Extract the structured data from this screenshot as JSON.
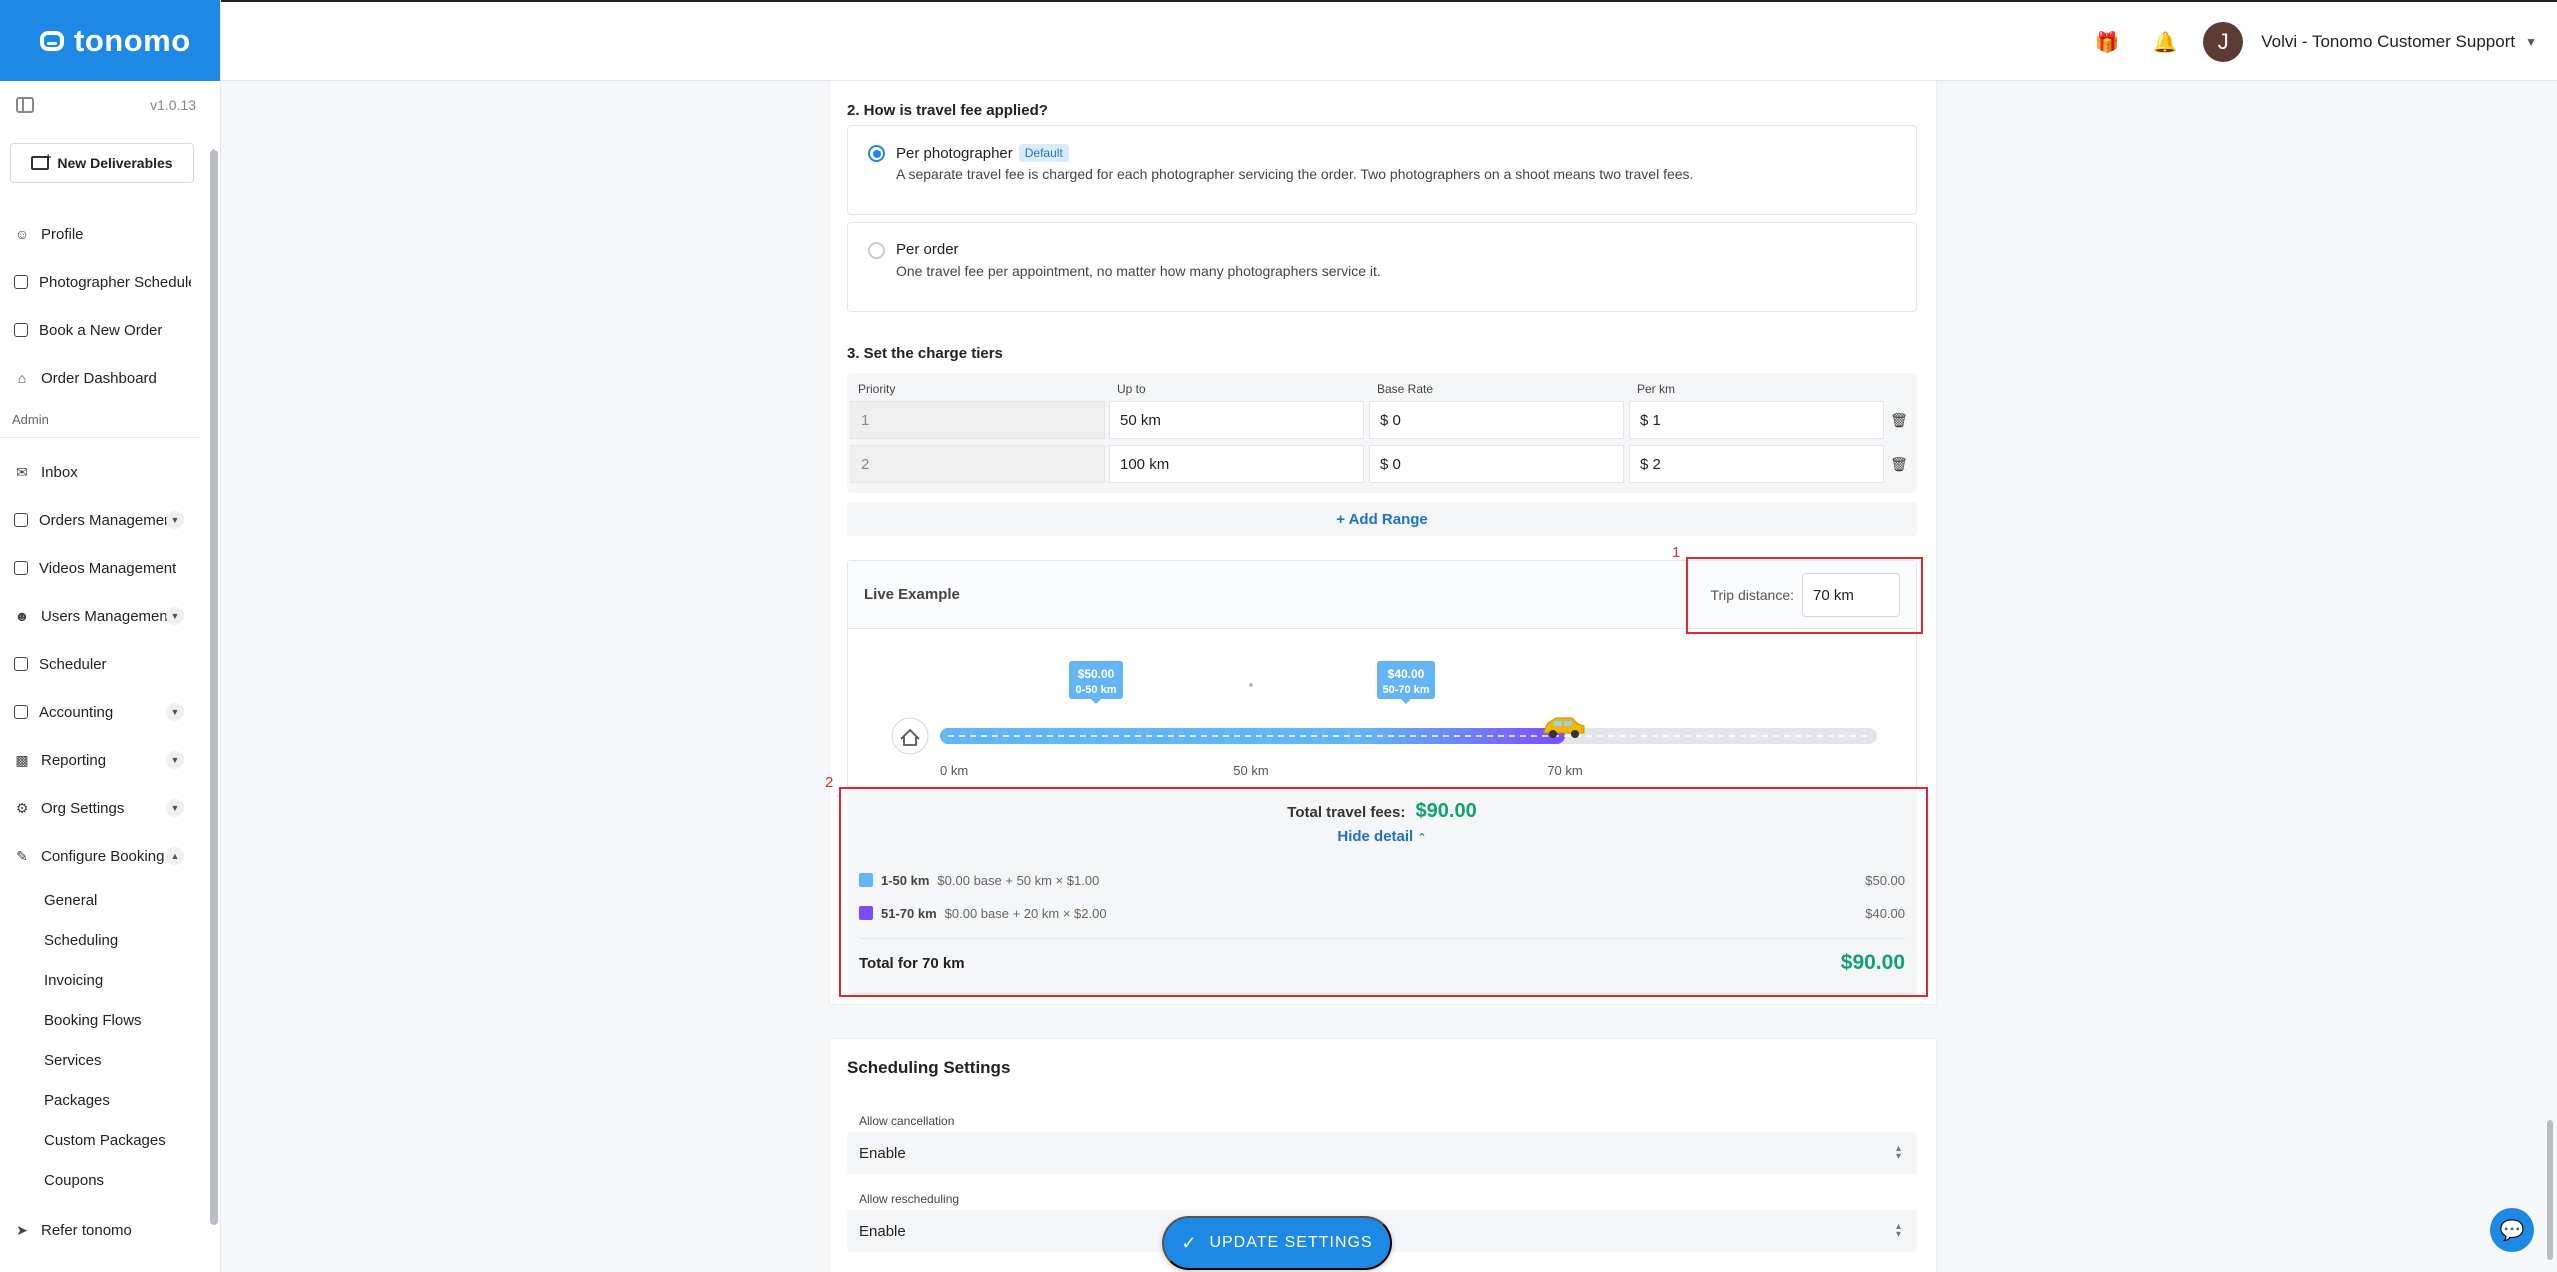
{
  "brand": {
    "name": "tonomo",
    "version": "v1.0.13"
  },
  "sidebar": {
    "new_deliverables": "New Deliverables",
    "items": [
      {
        "label": "Profile",
        "icon": "person-icon"
      },
      {
        "label": "Photographer Schedule",
        "icon": "schedule-icon"
      },
      {
        "label": "Book a New Order",
        "icon": "book-icon"
      },
      {
        "label": "Order Dashboard",
        "icon": "home-icon"
      }
    ],
    "section_admin": "Admin",
    "admin_items": [
      {
        "label": "Inbox",
        "icon": "mail-icon",
        "caret": false
      },
      {
        "label": "Orders Management",
        "icon": "orders-icon",
        "caret": true
      },
      {
        "label": "Videos Management",
        "icon": "video-icon",
        "caret": false
      },
      {
        "label": "Users Management",
        "icon": "users-icon",
        "caret": true
      },
      {
        "label": "Scheduler",
        "icon": "calendar-icon",
        "caret": false
      },
      {
        "label": "Accounting",
        "icon": "card-icon",
        "caret": true
      },
      {
        "label": "Reporting",
        "icon": "chart-icon",
        "caret": true
      },
      {
        "label": "Org Settings",
        "icon": "gear-icon",
        "caret": true
      },
      {
        "label": "Configure Booking",
        "icon": "pencil-icon",
        "caret": true
      }
    ],
    "sub_items": [
      "General",
      "Scheduling",
      "Invoicing",
      "Booking Flows",
      "Services",
      "Packages",
      "Custom Packages",
      "Coupons"
    ],
    "refer": "Refer tonomo"
  },
  "header": {
    "user": "Volvi - Tonomo Customer Support",
    "avatar_letter": "J"
  },
  "travel": {
    "q2": "2. How is travel fee applied?",
    "opt1_title": "Per photographer",
    "opt1_badge": "Default",
    "opt1_desc": "A separate travel fee is charged for each photographer servicing the order. Two photographers on a shoot means two travel fees.",
    "opt2_title": "Per order",
    "opt2_desc": "One travel fee per appointment, no matter how many photographers service it.",
    "selected": "Per photographer",
    "q3": "3. Set the charge tiers",
    "headers": [
      "Priority",
      "Up to",
      "Base Rate",
      "Per km"
    ],
    "rows": [
      {
        "priority": "1",
        "upto": "50 km",
        "base": "$ 0",
        "perkm": "$ 1"
      },
      {
        "priority": "2",
        "upto": "100 km",
        "base": "$ 0",
        "perkm": "$ 2"
      }
    ],
    "add_range": "+ Add Range"
  },
  "live": {
    "title": "Live Example",
    "trip_label": "Trip distance:",
    "trip_value": "70 km",
    "callout1": "1",
    "callout2": "2",
    "marker1_price": "$50.00",
    "marker1_range": "0-50 km",
    "marker2_price": "$40.00",
    "marker2_range": "50-70 km",
    "axis_labels": [
      "0 km",
      "50 km",
      "70 km"
    ],
    "progress_fraction": 0.667,
    "colors": {
      "tier1": "#64b5f6",
      "tier2": "#7c4dff",
      "total": "#10a36c"
    },
    "total_label": "Total travel fees:",
    "total_value": "$90.00",
    "hide_detail": "Hide detail",
    "breakdown": [
      {
        "range": "1-50 km",
        "detail": "$0.00 base + 50 km × $1.00",
        "amount": "$50.00"
      },
      {
        "range": "51-70 km",
        "detail": "$0.00 base + 20 km × $2.00",
        "amount": "$40.00"
      }
    ],
    "total_for_label": "Total for 70 km",
    "total_for_value": "$90.00"
  },
  "scheduling": {
    "title": "Scheduling Settings",
    "allow_cancel_label": "Allow cancellation",
    "allow_cancel_value": "Enable",
    "allow_resched_label": "Allow rescheduling",
    "allow_resched_value": "Enable"
  },
  "update_button": "UPDATE SETTINGS"
}
